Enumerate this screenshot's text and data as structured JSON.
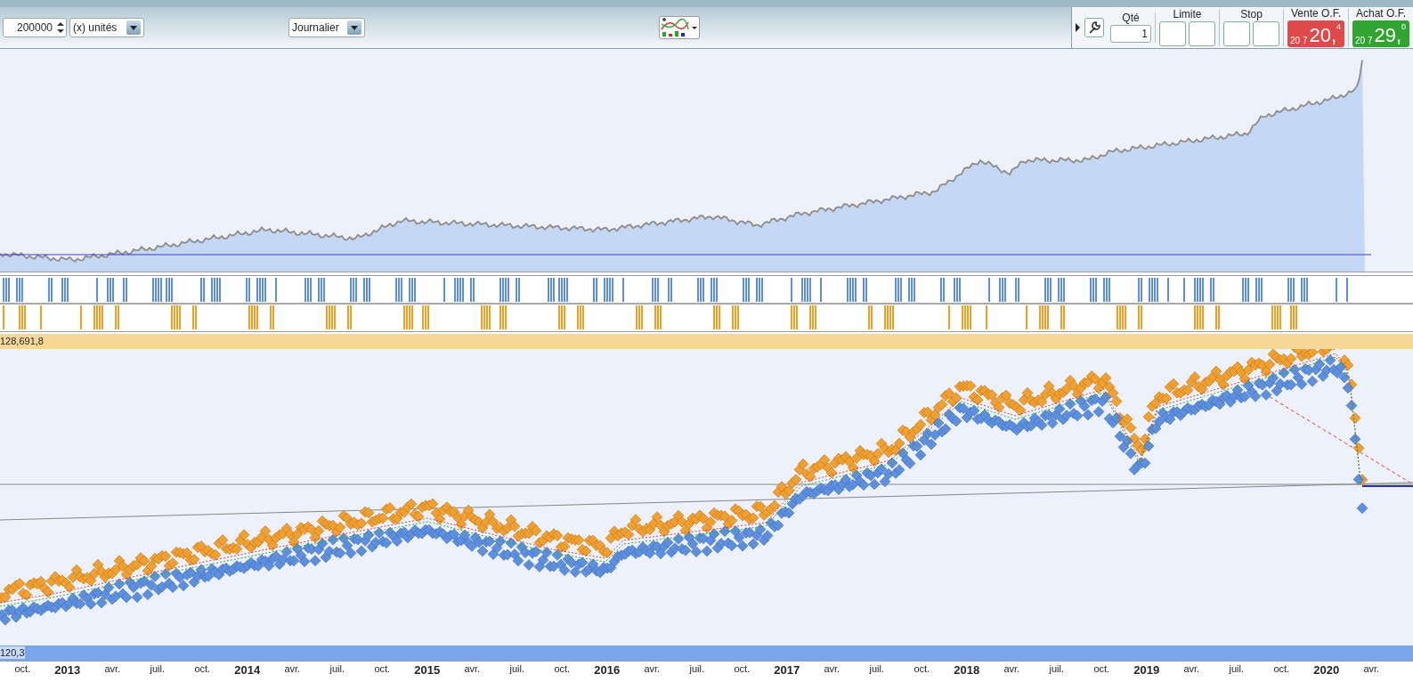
{
  "toolbar": {
    "quantity": "200000",
    "unit": "(x) unités",
    "period": "Journalier"
  },
  "order_panel": {
    "qty_label": "Qté",
    "qty": "1",
    "limit_label": "Limite",
    "stop_label": "Stop",
    "sell": {
      "label": "Vente O.F.",
      "prefix": "20 7",
      "price": "20,",
      "suffix": "4"
    },
    "buy": {
      "label": "Achat O.F.",
      "prefix": "20 7",
      "price": "29,",
      "suffix": "0"
    }
  },
  "strips": {
    "upper_label": "128,691,8",
    "lower_label": "120,3"
  },
  "x_axis": {
    "labels": [
      {
        "text": "oct.",
        "kind": "month"
      },
      {
        "text": "2013",
        "kind": "year"
      },
      {
        "text": "avr.",
        "kind": "month"
      },
      {
        "text": "juil.",
        "kind": "month"
      },
      {
        "text": "oct.",
        "kind": "month"
      },
      {
        "text": "2014",
        "kind": "year"
      },
      {
        "text": "avr.",
        "kind": "month"
      },
      {
        "text": "juil.",
        "kind": "month"
      },
      {
        "text": "oct.",
        "kind": "month"
      },
      {
        "text": "2015",
        "kind": "year"
      },
      {
        "text": "avr.",
        "kind": "month"
      },
      {
        "text": "juil.",
        "kind": "month"
      },
      {
        "text": "oct.",
        "kind": "month"
      },
      {
        "text": "2016",
        "kind": "year"
      },
      {
        "text": "avr.",
        "kind": "month"
      },
      {
        "text": "juil.",
        "kind": "month"
      },
      {
        "text": "oct.",
        "kind": "month"
      },
      {
        "text": "2017",
        "kind": "year"
      },
      {
        "text": "avr.",
        "kind": "month"
      },
      {
        "text": "juil.",
        "kind": "month"
      },
      {
        "text": "oct.",
        "kind": "month"
      },
      {
        "text": "2018",
        "kind": "year"
      },
      {
        "text": "avr.",
        "kind": "month"
      },
      {
        "text": "juil.",
        "kind": "month"
      },
      {
        "text": "oct.",
        "kind": "month"
      },
      {
        "text": "2019",
        "kind": "year"
      },
      {
        "text": "avr.",
        "kind": "month"
      },
      {
        "text": "juil.",
        "kind": "month"
      },
      {
        "text": "oct.",
        "kind": "month"
      },
      {
        "text": "2020",
        "kind": "year"
      },
      {
        "text": "avr.",
        "kind": "month"
      }
    ]
  }
}
